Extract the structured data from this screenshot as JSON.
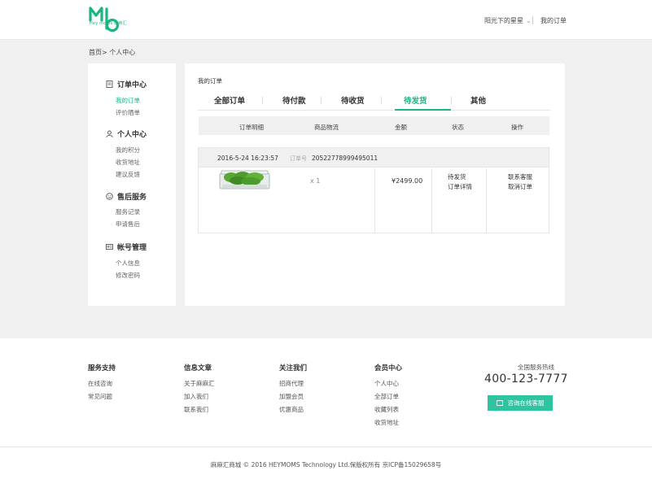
{
  "header": {
    "logo_text": "Hey moms 麻麻汇",
    "username": "阳光下的星星",
    "my_orders_link": "我的订单"
  },
  "breadcrumb": {
    "home": "首页>",
    "current": "个人中心"
  },
  "sidebar": {
    "groups": [
      {
        "title": "订单中心",
        "items": [
          "我的订单",
          "评价晒单"
        ]
      },
      {
        "title": "个人中心",
        "items": [
          "我的积分",
          "收货地址",
          "建议反馈"
        ]
      },
      {
        "title": "售后服务",
        "items": [
          "服务记录",
          "申请售后"
        ]
      },
      {
        "title": "帐号管理",
        "items": [
          "个人信息",
          "修改密码"
        ]
      }
    ],
    "active_item": "我的订单"
  },
  "main": {
    "section_title": "我的订单",
    "tabs": [
      "全部订单",
      "待付款",
      "待收货",
      "待发货",
      "其他"
    ],
    "active_tab": "待发货",
    "columns": [
      "订单明细",
      "商品物流",
      "金额",
      "状态",
      "操作"
    ]
  },
  "order": {
    "date": "2016-5-24 16:23:57",
    "number_label": "订单号",
    "number": "20522778999495011",
    "quantity": "x 1",
    "amount": "¥2499.00",
    "status": "待发货",
    "status_link": "订单详情",
    "action_contact": "联系客服",
    "action_cancel": "取消订单"
  },
  "footer": {
    "columns": [
      {
        "title": "服务支持",
        "links": [
          "在线咨询",
          "常见问题"
        ]
      },
      {
        "title": "信息文章",
        "links": [
          "关于麻麻汇",
          "加入我们",
          "联系我们"
        ]
      },
      {
        "title": "关注我们",
        "links": [
          "招商代理",
          "加盟会员",
          "优惠商品"
        ]
      },
      {
        "title": "会员中心",
        "links": [
          "个人中心",
          "全部订单",
          "收藏列表",
          "收货地址"
        ]
      }
    ],
    "hotline_label": "全国服务热线",
    "hotline_number": "400-123-7777",
    "consult_button": "咨询在线客服",
    "copyright": "麻麻汇商城 © 2016 HEYMOMS Technology Ltd.保版权所有  京ICP备15029658号"
  },
  "colors": {
    "accent": "#1bb584",
    "button": "#2ec4a0"
  }
}
